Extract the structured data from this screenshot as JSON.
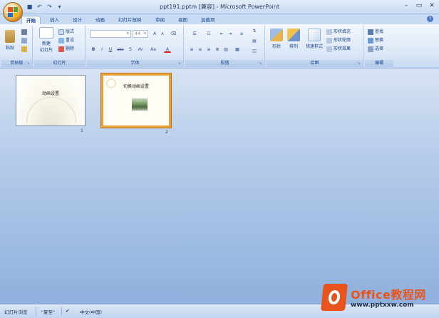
{
  "window": {
    "title": "ppt191.pptm [兼容] - Microsoft PowerPoint",
    "quick_access": [
      "save-icon",
      "undo-icon",
      "redo-icon",
      "customize-icon"
    ]
  },
  "tabs": [
    "开始",
    "插入",
    "设计",
    "动画",
    "幻灯片放映",
    "审阅",
    "视图",
    "加载项"
  ],
  "active_tab": "开始",
  "ribbon": {
    "clipboard": {
      "label": "剪贴板",
      "paste": "粘贴"
    },
    "slides": {
      "label": "幻灯片",
      "new_slide": "新建",
      "new_slide2": "幻灯片",
      "layout": "版式",
      "reset": "重设",
      "delete": "删除"
    },
    "font": {
      "label": "字体",
      "font_name": "",
      "font_size": "44",
      "bold": "B",
      "italic": "I",
      "underline": "U",
      "strike": "abe",
      "shadow": "S",
      "spacing": "AV",
      "case": "Aa",
      "color": "A",
      "grow": "A",
      "shrink": "A"
    },
    "paragraph": {
      "label": "段落"
    },
    "drawing": {
      "label": "绘图",
      "shapes": "形状",
      "arrange": "排列",
      "quick_styles": "快速样式",
      "fill": "形状填充",
      "outline": "形状轮廓",
      "effects": "形状效果"
    },
    "editing": {
      "label": "编辑",
      "find": "查找",
      "replace": "替换",
      "select": "选择"
    }
  },
  "slides": [
    {
      "number": "1",
      "title": "动画设置"
    },
    {
      "number": "2",
      "title": "切换动画设置"
    }
  ],
  "status": {
    "view": "幻灯片浏览",
    "theme": "\"夏至\"",
    "language": "中文(中国)"
  },
  "watermark": {
    "title": "Office教程网",
    "url": "www.pptxxw.com"
  },
  "colors": {
    "selection": "#e8a23a",
    "accent": "#15428b",
    "watermark": "#e8541e"
  }
}
